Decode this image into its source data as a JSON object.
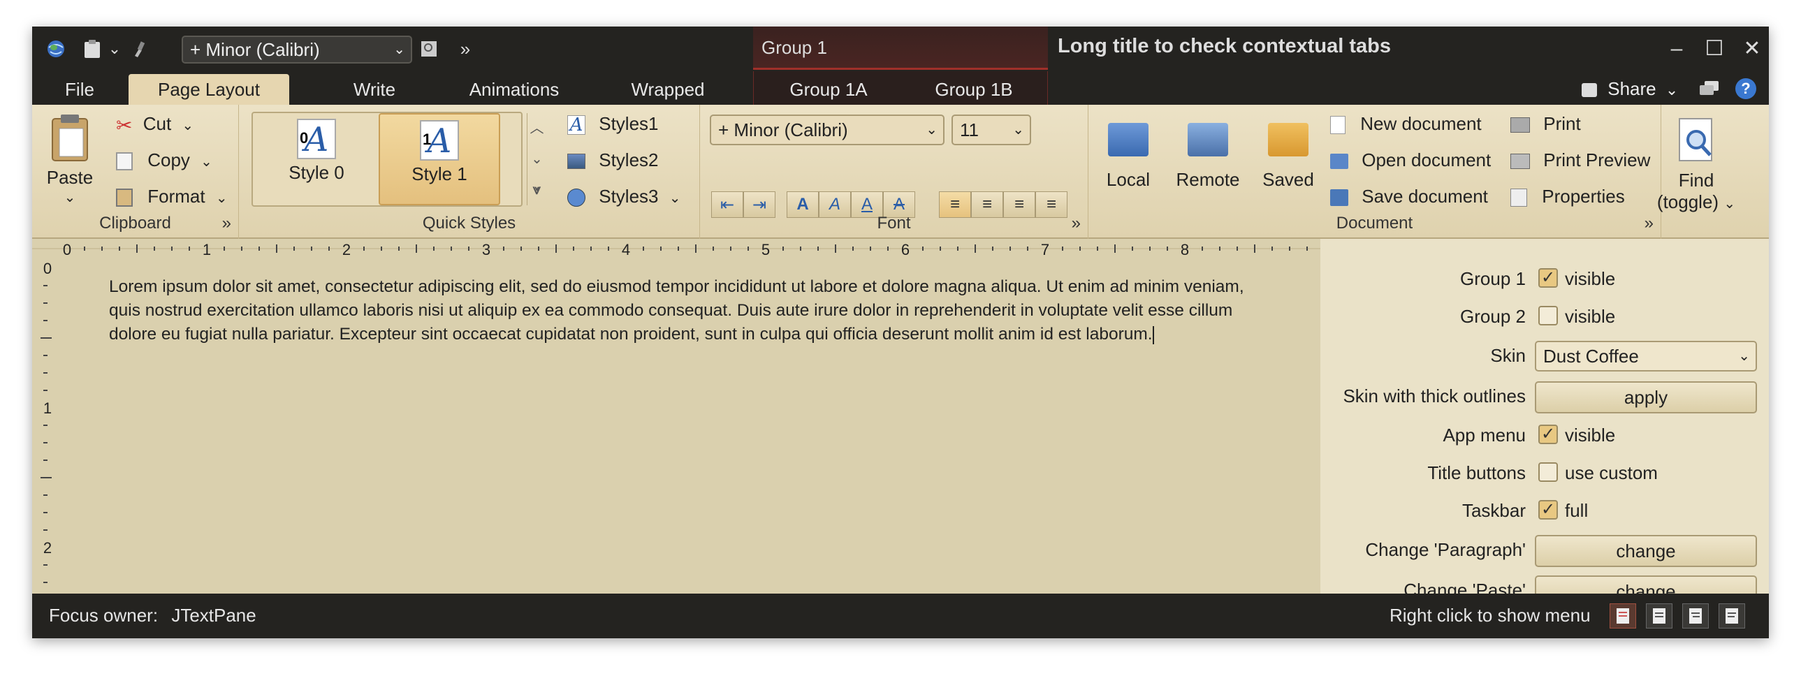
{
  "titlebar": {
    "qa_font_combo": "+ Minor (Calibri)",
    "contextual_group": "Group 1",
    "window_title": "Long title to check contextual tabs"
  },
  "tabs": [
    {
      "label": "File"
    },
    {
      "label": "Page Layout"
    },
    {
      "label": "Write"
    },
    {
      "label": "Animations"
    },
    {
      "label": "Wrapped"
    }
  ],
  "contextual_tabs": [
    {
      "label": "Group 1A"
    },
    {
      "label": "Group 1B"
    }
  ],
  "share_label": "Share",
  "clipboard": {
    "paste": "Paste",
    "cut": "Cut",
    "copy": "Copy",
    "format": "Format",
    "title": "Clipboard"
  },
  "quick_styles": {
    "style0": "Style 0",
    "style0_num": "0",
    "style1": "Style 1",
    "style1_num": "1",
    "styles1": "Styles1",
    "styles2": "Styles2",
    "styles3": "Styles3",
    "title": "Quick Styles"
  },
  "font": {
    "family": "+ Minor (Calibri)",
    "size": "11",
    "title": "Font"
  },
  "document": {
    "local": "Local",
    "remote": "Remote",
    "saved": "Saved",
    "new_document": "New document",
    "open_document": "Open document",
    "save_document": "Save document",
    "print": "Print",
    "print_preview": "Print Preview",
    "properties": "Properties",
    "title": "Document"
  },
  "find": {
    "line1": "Find",
    "line2": "(toggle)"
  },
  "ruler": {
    "h": [
      "0",
      "1",
      "2",
      "3",
      "4",
      "5",
      "6",
      "7",
      "8"
    ],
    "v": [
      "0",
      "1",
      "2"
    ]
  },
  "document_text": "Lorem ipsum dolor sit amet, consectetur adipiscing elit, sed do eiusmod tempor incididunt ut labore et dolore magna aliqua. Ut enim ad minim veniam, quis nostrud exercitation ullamco laboris nisi ut aliquip ex ea commodo consequat. Duis aute irure dolor in reprehenderit in voluptate velit esse cillum dolore eu fugiat nulla pariatur. Excepteur sint occaecat cupidatat non proident, sunt in culpa qui officia deserunt mollit anim id est laborum.",
  "panel": {
    "group1_label": "Group 1",
    "group1_check": "visible",
    "group1_checked": true,
    "group2_label": "Group 2",
    "group2_check": "visible",
    "group2_checked": false,
    "skin_label": "Skin",
    "skin_value": "Dust Coffee",
    "thick_label": "Skin with thick outlines",
    "thick_button": "apply",
    "appmenu_label": "App menu",
    "appmenu_check": "visible",
    "appmenu_checked": true,
    "titlebuttons_label": "Title buttons",
    "titlebuttons_check": "use custom",
    "titlebuttons_checked": false,
    "taskbar_label": "Taskbar",
    "taskbar_check": "full",
    "taskbar_checked": true,
    "paragraph_label": "Change 'Paragraph'",
    "paragraph_button": "change",
    "paste_label": "Change 'Paste'",
    "paste_button": "change"
  },
  "status": {
    "focus_label": "Focus owner:",
    "focus_value": "JTextPane",
    "hint": "Right click to show menu"
  },
  "colors": {
    "ribbon": "#e6d9b7",
    "accent": "#a0302a",
    "chrome": "#242320"
  }
}
